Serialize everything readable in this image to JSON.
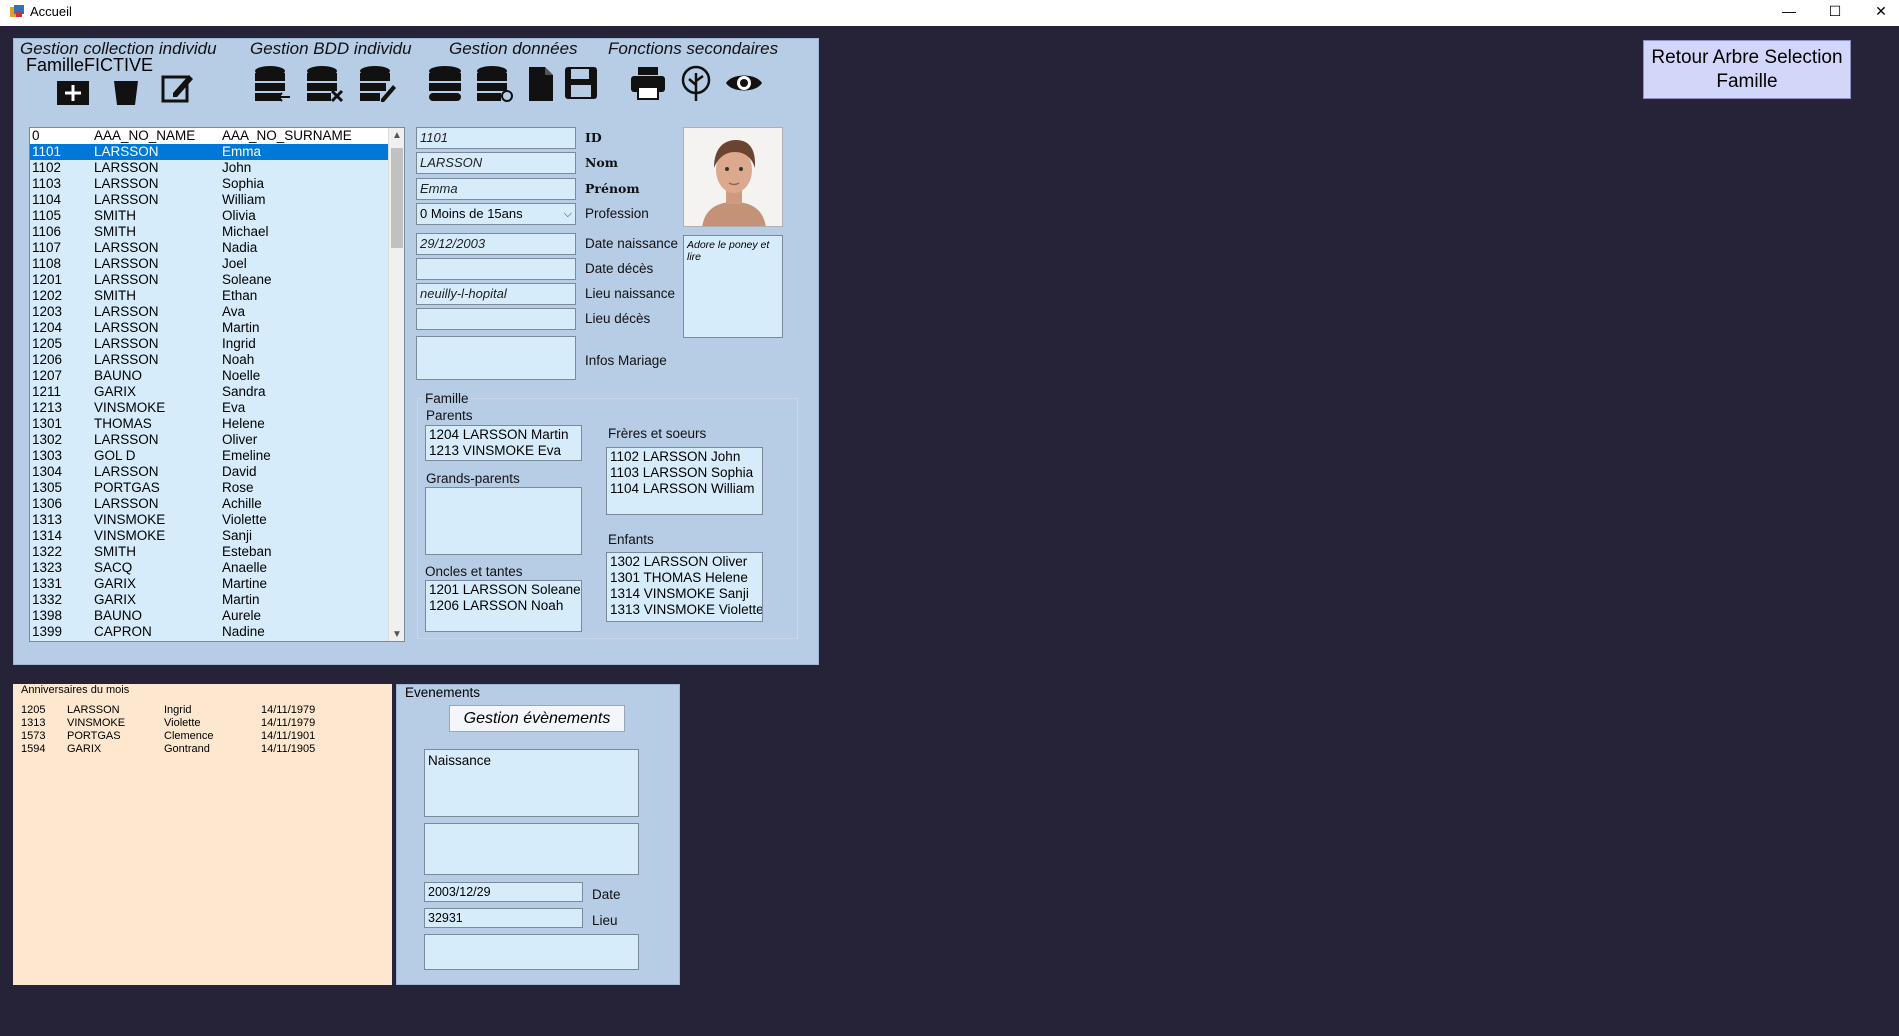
{
  "window": {
    "title": "Accueil",
    "minimize": "—",
    "maximize": "☐",
    "close": "✕"
  },
  "menus": {
    "collection": "Gestion collection individu",
    "bdd": "Gestion BDD individu",
    "donnees": "Gestion données",
    "secondaires": "Fonctions secondaires"
  },
  "famille_name": "FamilleFICTIVE",
  "retour_button": {
    "line1": "Retour Arbre Selection",
    "line2": "Famille"
  },
  "individus": [
    [
      "0",
      "AAA_NO_NAME",
      "AAA_NO_SURNAME"
    ],
    [
      "1101",
      "LARSSON",
      "Emma"
    ],
    [
      "1102",
      "LARSSON",
      "John"
    ],
    [
      "1103",
      "LARSSON",
      "Sophia"
    ],
    [
      "1104",
      "LARSSON",
      "William"
    ],
    [
      "1105",
      "SMITH",
      "Olivia"
    ],
    [
      "1106",
      "SMITH",
      "Michael"
    ],
    [
      "1107",
      "LARSSON",
      "Nadia"
    ],
    [
      "1108",
      "LARSSON",
      "Joel"
    ],
    [
      "1201",
      "LARSSON",
      "Soleane"
    ],
    [
      "1202",
      "SMITH",
      "Ethan"
    ],
    [
      "1203",
      "LARSSON",
      "Ava"
    ],
    [
      "1204",
      "LARSSON",
      "Martin"
    ],
    [
      "1205",
      "LARSSON",
      "Ingrid"
    ],
    [
      "1206",
      "LARSSON",
      "Noah"
    ],
    [
      "1207",
      "BAUNO",
      "Noelle"
    ],
    [
      "1211",
      "GARIX",
      "Sandra"
    ],
    [
      "1213",
      "VINSMOKE",
      "Eva"
    ],
    [
      "1301",
      "THOMAS",
      "Helene"
    ],
    [
      "1302",
      "LARSSON",
      "Oliver"
    ],
    [
      "1303",
      "GOL D",
      "Emeline"
    ],
    [
      "1304",
      "LARSSON",
      "David"
    ],
    [
      "1305",
      "PORTGAS",
      "Rose"
    ],
    [
      "1306",
      "LARSSON",
      "Achille"
    ],
    [
      "1313",
      "VINSMOKE",
      "Violette"
    ],
    [
      "1314",
      "VINSMOKE",
      "Sanji"
    ],
    [
      "1322",
      "SMITH",
      "Esteban"
    ],
    [
      "1323",
      "SACQ",
      "Anaelle"
    ],
    [
      "1331",
      "GARIX",
      "Martine"
    ],
    [
      "1332",
      "GARIX",
      "Martin"
    ],
    [
      "1398",
      "BAUNO",
      "Aurele"
    ],
    [
      "1399",
      "CAPRON",
      "Nadine"
    ]
  ],
  "selected_index": 1,
  "fields": {
    "id": {
      "value": "1101",
      "label": "ID"
    },
    "nom": {
      "value": "LARSSON",
      "label": "Nom"
    },
    "prenom": {
      "value": "Emma",
      "label": "Prénom"
    },
    "profession": {
      "value": "0 Moins de 15ans",
      "label": "Profession"
    },
    "date_naissance": {
      "value": "29/12/2003",
      "label": "Date naissance"
    },
    "date_deces": {
      "value": "",
      "label": "Date décès"
    },
    "lieu_naissance": {
      "value": "neuilly-l-hopital",
      "label": "Lieu naissance"
    },
    "lieu_deces": {
      "value": "",
      "label": "Lieu décès"
    },
    "infos_mariage": {
      "value": "",
      "label": "Infos Mariage"
    }
  },
  "note": "Adore le poney et lire",
  "famille": {
    "title": "Famille",
    "parents_label": "Parents",
    "parents": [
      "1204 LARSSON Martin",
      "1213 VINSMOKE Eva"
    ],
    "grands_parents_label": "Grands-parents",
    "grands_parents": [],
    "oncles_label": "Oncles et tantes",
    "oncles": [
      "1201 LARSSON Soleane",
      "1206 LARSSON Noah"
    ],
    "freres_label": "Frères et soeurs",
    "freres": [
      "1102 LARSSON John",
      "1103 LARSSON Sophia",
      "1104 LARSSON William"
    ],
    "enfants_label": "Enfants",
    "enfants": [
      "1302 LARSSON Oliver",
      "1301 THOMAS Helene",
      "1314 VINSMOKE Sanji",
      "1313 VINSMOKE Violette"
    ]
  },
  "anniversaires": {
    "title": "Anniversaires du mois",
    "rows": [
      [
        "1205",
        "LARSSON",
        "Ingrid",
        "14/11/1979"
      ],
      [
        "1313",
        "VINSMOKE",
        "Violette",
        "14/11/1979"
      ],
      [
        "1573",
        "PORTGAS",
        "Clemence",
        "14/11/1901"
      ],
      [
        "1594",
        "GARIX",
        "Gontrand",
        "14/11/1905"
      ]
    ]
  },
  "evenements": {
    "title": "Evenements",
    "gestion_button": "Gestion évènements",
    "event_type": "Naissance",
    "event_detail": "",
    "date_value": "2003/12/29",
    "date_label": "Date",
    "lieu_value": "32931",
    "lieu_label": "Lieu",
    "extra": ""
  },
  "colors": {
    "panel": "#b7cde6",
    "field": "#d6ecfb",
    "selection": "#0078d7",
    "anniv_bg": "#fde8cf",
    "background": "#262338"
  }
}
